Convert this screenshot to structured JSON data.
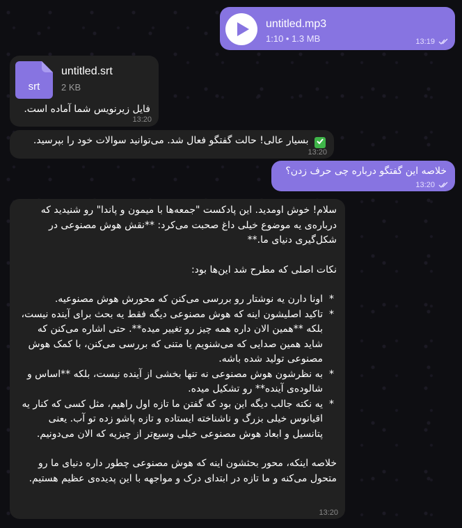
{
  "audio_message": {
    "title": "untitled.mp3",
    "meta": "1:10 • 1.3 MB",
    "time": "13:19",
    "icon": "play-icon"
  },
  "file_message": {
    "extension": "srt",
    "name": "untitled.srt",
    "size": "2 KB",
    "caption": "فایل زیرنویس شما آماده است.",
    "time": "13:20",
    "icon": "file-icon"
  },
  "status_message": {
    "text": "بسیار عالی! حالت گفتگو فعال شد. می‌توانید سوالات خود را بپرسید.",
    "emoji": "✅",
    "time": "13:20"
  },
  "question_message": {
    "text": "خلاصه این گفتگو درباره چی حرف زدن؟",
    "time": "13:20"
  },
  "answer_message": {
    "intro": "سلام! خوش اومدید. این پادکست \"جمعه‌ها با میمون و پاندا\" رو شنیدید که درباره‌ی یه موضوع خیلی داغ صحبت می‌کرد: **نقش هوش مصنوعی در شکل‌گیری دنیای ما.**",
    "points_heading": "نکات اصلی که مطرح شد این‌ها بود:",
    "points": [
      "اونا دارن یه نوشتار رو بررسی می‌کنن که محورش هوش مصنوعیه.",
      "تاکید اصلیشون اینه که هوش مصنوعی دیگه فقط یه بحث برای آینده نیست، بلکه **همین الان داره همه چیز رو تغییر میده**. حتی اشاره می‌کنن که شاید همین صدایی که می‌شنویم یا متنی که بررسی می‌کنن، با کمک هوش مصنوعی تولید شده باشه.",
      "به نظرشون هوش مصنوعی نه تنها بخشی از آینده نیست، بلکه **اساس و شالوده‌ی آینده** رو تشکیل میده.",
      "یه نکته جالب دیگه این بود که گفتن ما تازه اول راهیم، مثل کسی که کنار یه اقیانوس خیلی بزرگ و ناشناخته ایستاده و تازه پاشو زده تو آب. یعنی پتانسیل و ابعاد هوش مصنوعی خیلی وسیع‌تر از چیزیه که الان می‌دونیم."
    ],
    "conclusion": "خلاصه اینکه، محور بحثشون اینه که هوش مصنوعی چطور داره دنیای ما رو متحول می‌کنه و ما تازه در ابتدای درک و مواجهه با این پدیده‌ی عظیم هستیم.",
    "time": "13:20"
  },
  "colors": {
    "outgoing_bubble": "#8774e1",
    "incoming_bubble": "#212121",
    "background": "#0e0e12"
  }
}
